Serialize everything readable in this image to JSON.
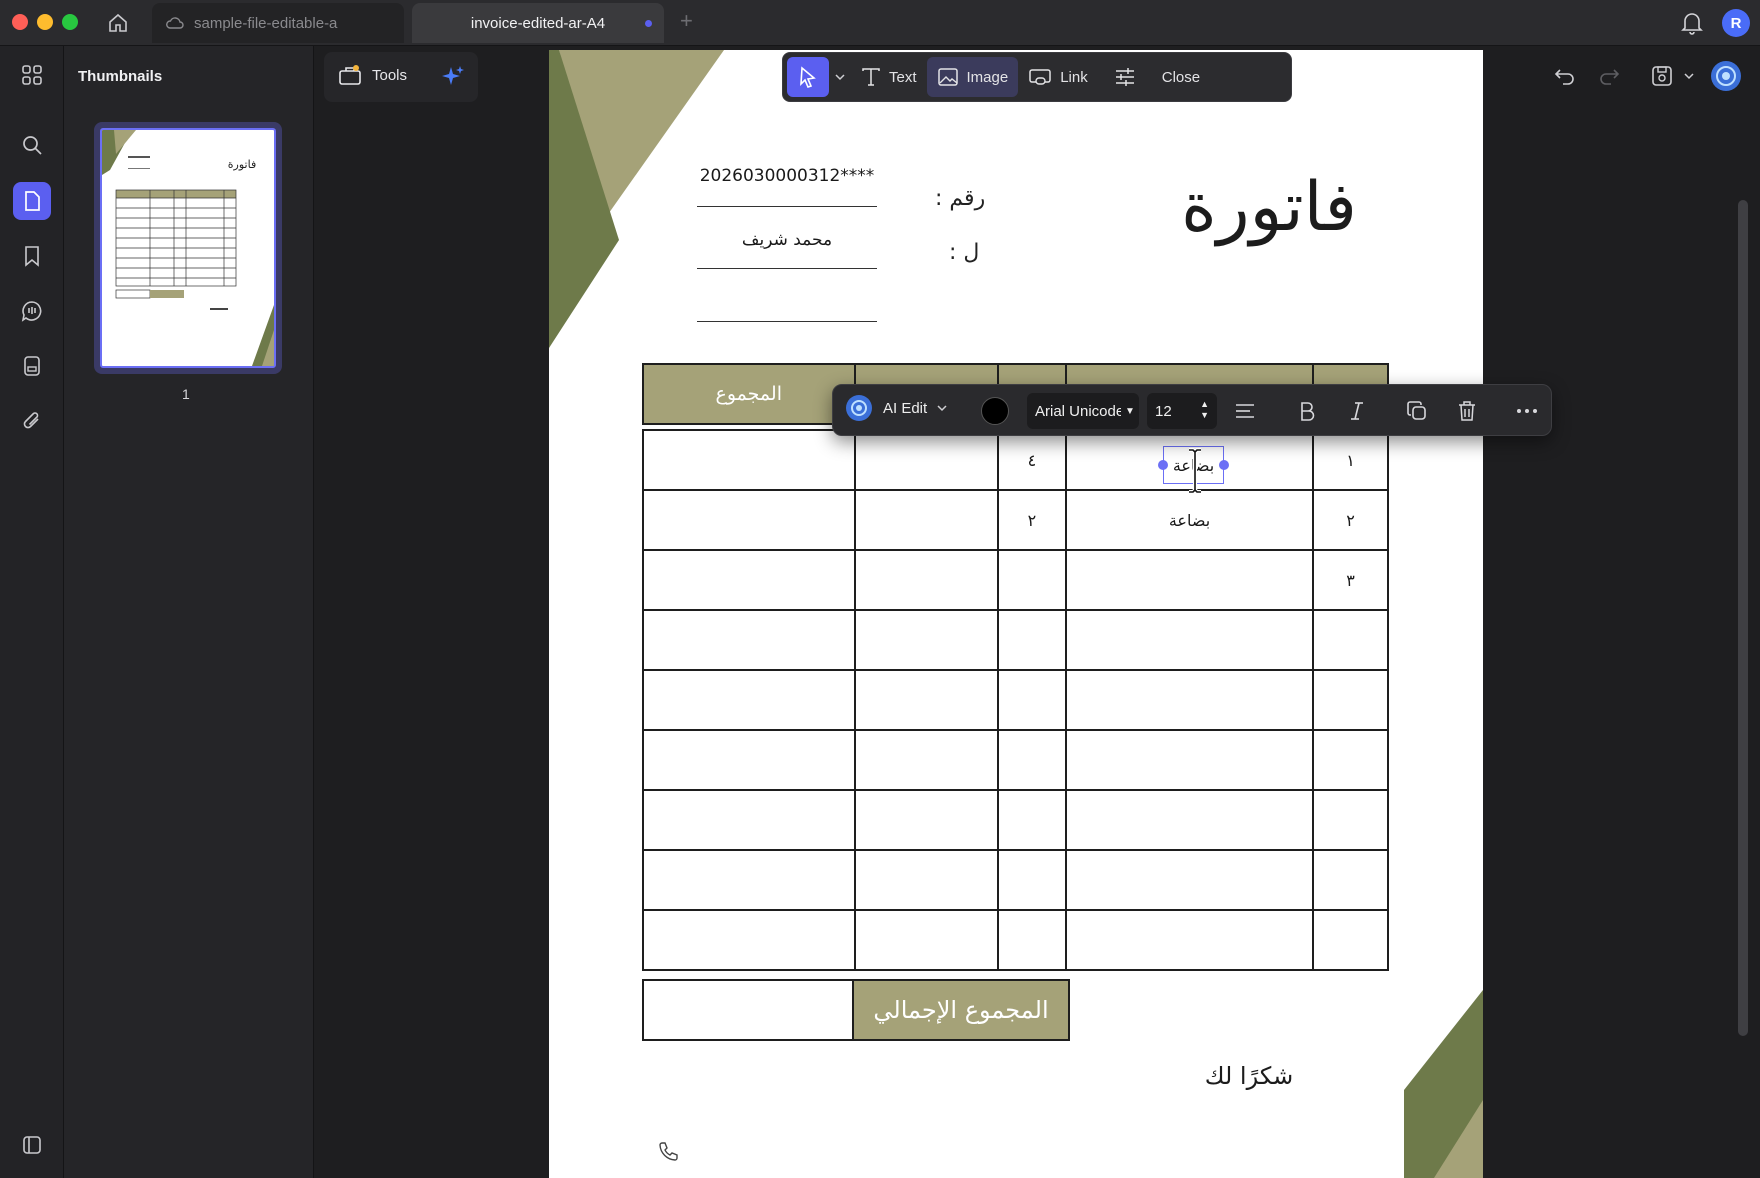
{
  "tabs": [
    {
      "label": "sample-file-editable-a"
    },
    {
      "label": "invoice-edited-ar-A4"
    }
  ],
  "user": {
    "avatar_initial": "R"
  },
  "sidebar": {
    "title": "Thumbnails",
    "page_number": "1"
  },
  "tools": {
    "label": "Tools"
  },
  "edit_toolbar": {
    "text_label": "Text",
    "image_label": "Image",
    "link_label": "Link",
    "close_label": "Close"
  },
  "format_bar": {
    "ai_label": "AI Edit",
    "font": "Arial Unicode",
    "size": "12",
    "text_color": "#000000"
  },
  "invoice": {
    "title": "فاتورة",
    "number_label": "رقم :",
    "number_value": "2026030000312****",
    "to_label": "ل :",
    "to_value": "محمد شريف",
    "table_header_total": "المجموع",
    "rows": [
      {
        "no": "١",
        "item": "بضاعة",
        "qty": "٤"
      },
      {
        "no": "٢",
        "item": "بضاعة",
        "qty": "٢"
      },
      {
        "no": "٣",
        "item": "",
        "qty": ""
      },
      {
        "no": "",
        "item": "",
        "qty": ""
      },
      {
        "no": "",
        "item": "",
        "qty": ""
      },
      {
        "no": "",
        "item": "",
        "qty": ""
      },
      {
        "no": "",
        "item": "",
        "qty": ""
      },
      {
        "no": "",
        "item": "",
        "qty": ""
      },
      {
        "no": "",
        "item": "",
        "qty": ""
      }
    ],
    "grand_total_label": "المجموع الإجمالي",
    "thanks": "شكرًا لك"
  },
  "colors": {
    "accent": "#5b5ff0",
    "olive_header": "#a5a278",
    "olive_dark": "#6e7a4a"
  }
}
